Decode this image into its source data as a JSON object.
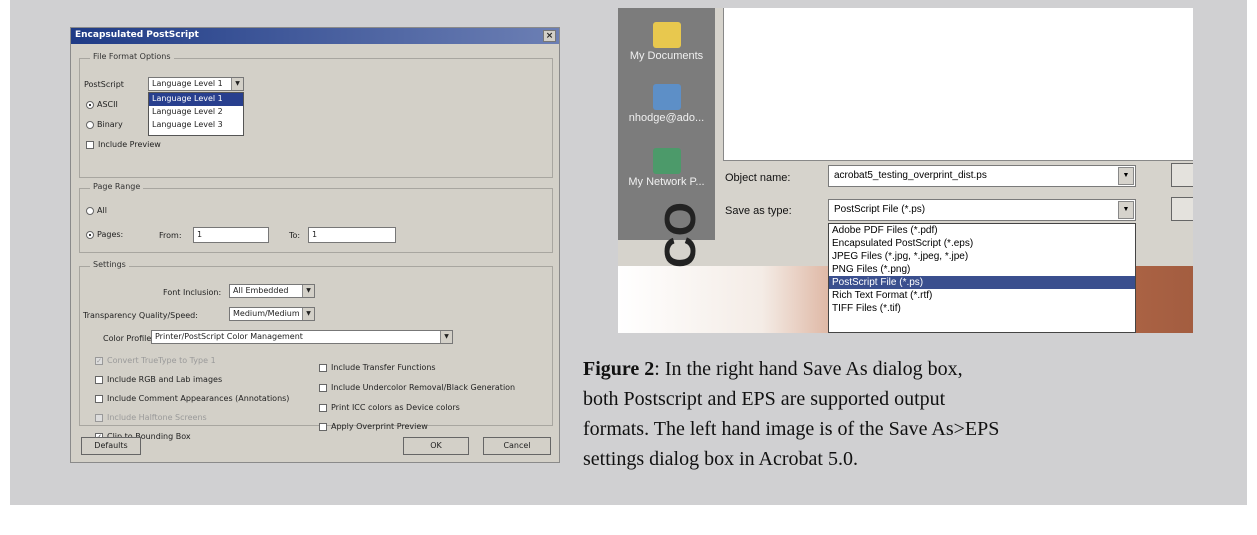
{
  "eps_dialog": {
    "title": "Encapsulated PostScript",
    "close_glyph": "×",
    "file_format": {
      "group_label": "File Format Options",
      "postscript_label": "PostScript",
      "postscript_value": "Language Level 1",
      "ascii_label": "ASCII",
      "binary_label": "Binary",
      "include_preview_label": "Include Preview",
      "language_levels": [
        "Language Level 1",
        "Language Level 2",
        "Language Level 3"
      ]
    },
    "page_range": {
      "group_label": "Page Range",
      "all_label": "All",
      "pages_label": "Pages:",
      "from_label": "From:",
      "from_value": "1",
      "to_label": "To:",
      "to_value": "1"
    },
    "settings": {
      "group_label": "Settings",
      "font_inclusion_label": "Font Inclusion:",
      "font_inclusion_value": "All Embedded",
      "transparency_label": "Transparency Quality/Speed:",
      "transparency_value": "Medium/Medium",
      "color_profile_label": "Color Profile:",
      "color_profile_value": "Printer/PostScript Color Management",
      "left_checks": [
        {
          "label": "Convert TrueType to Type 1",
          "checked": true,
          "disabled": true
        },
        {
          "label": "Include RGB and Lab images",
          "checked": false,
          "disabled": false
        },
        {
          "label": "Include Comment Appearances (Annotations)",
          "checked": false,
          "disabled": false
        },
        {
          "label": "Include Halftone Screens",
          "checked": false,
          "disabled": true
        },
        {
          "label": "Clip to Bounding Box",
          "checked": true,
          "disabled": false
        }
      ],
      "right_checks": [
        {
          "label": "Include Transfer Functions",
          "checked": false
        },
        {
          "label": "Include Undercolor Removal/Black Generation",
          "checked": false
        },
        {
          "label": "Print ICC colors as Device colors",
          "checked": false
        },
        {
          "label": "Apply Overprint Preview",
          "checked": false
        }
      ]
    },
    "buttons": {
      "defaults": "Defaults",
      "ok": "OK",
      "cancel": "Cancel"
    }
  },
  "saveas_dialog": {
    "places": [
      "My Documents",
      "nhodge@ado...",
      "My Network P..."
    ],
    "object_name_label": "Object name:",
    "object_name_value": "acrobat5_testing_overprint_dist.ps",
    "save_as_type_label": "Save as type:",
    "save_as_type_value": "PostScript File (*.ps)",
    "type_options": [
      "Adobe PDF Files (*.pdf)",
      "Encapsulated PostScript (*.eps)",
      "JPEG Files (*.jpg, *.jpeg, *.jpe)",
      "PNG Files (*.png)",
      "PostScript File (*.ps)",
      "Rich Text Format (*.rtf)",
      "TIFF Files (*.tif)"
    ],
    "selected_type_index": 4,
    "background_letters": "CO"
  },
  "caption": {
    "figure_label": "Figure 2",
    "text": ": In the right hand Save As dialog box, both Postscript and EPS are supported output formats. The left hand image is of the Save As>EPS settings dialog box in Acrobat 5.0."
  },
  "colors": {
    "panel_bg": "#d0d0d2",
    "dialog_face": "#d3d0c8",
    "selection": "#283f8e"
  }
}
